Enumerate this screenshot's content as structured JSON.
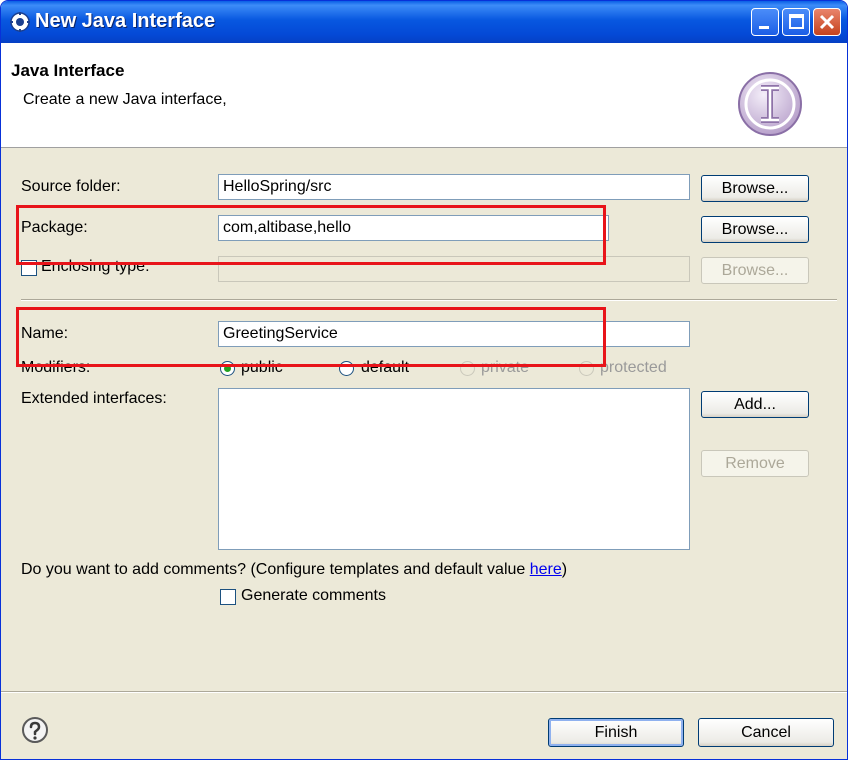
{
  "window": {
    "title": "New Java Interface",
    "accent": "#0449d6"
  },
  "header": {
    "title": "Java Interface",
    "description": "Create a new Java interface,",
    "icon": "interface-i-icon"
  },
  "source_folder": {
    "label": "Source folder:",
    "value": "HelloSpring/src",
    "browse": "Browse..."
  },
  "package": {
    "label": "Package:",
    "value": "com,altibase,hello",
    "browse": "Browse..."
  },
  "enclosing_type": {
    "label": "Enclosing type:",
    "value": "",
    "browse": "Browse...",
    "checked": false,
    "enabled": false
  },
  "name": {
    "label": "Name:",
    "value": "GreetingService"
  },
  "modifiers": {
    "label": "Modifiers:",
    "options": [
      {
        "label": "public",
        "checked": true,
        "enabled": true
      },
      {
        "label": "default",
        "checked": false,
        "enabled": true
      },
      {
        "label": "private",
        "checked": false,
        "enabled": false
      },
      {
        "label": "protected",
        "checked": false,
        "enabled": false
      }
    ]
  },
  "extended_interfaces": {
    "label": "Extended interfaces:",
    "add": "Add...",
    "remove": "Remove"
  },
  "comments": {
    "question": "Do you want to add comments? (Configure templates and default value ",
    "link": "here",
    "question_end": ")",
    "generate_label": "Generate comments",
    "generate_checked": false
  },
  "footer": {
    "finish": "Finish",
    "cancel": "Cancel",
    "help_icon": "help-icon"
  },
  "highlight_color": "#e8141a"
}
